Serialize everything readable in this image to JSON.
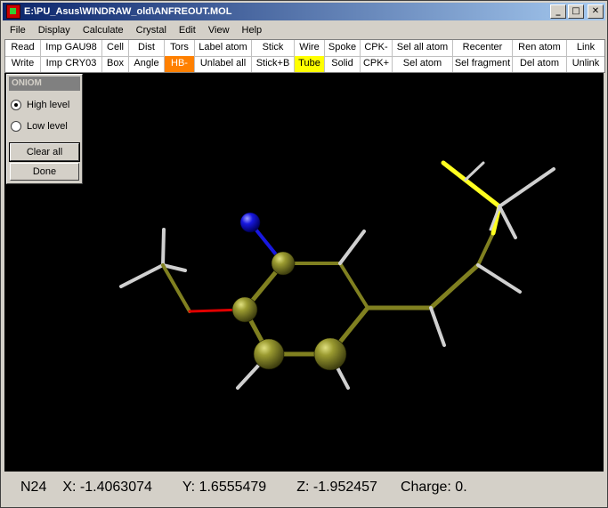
{
  "window": {
    "title": "E:\\PU_Asus\\WINDRAW_old\\ANFREOUT.MOL"
  },
  "menu": [
    "File",
    "Display",
    "Calculate",
    "Crystal",
    "Edit",
    "View",
    "Help"
  ],
  "toolbar": {
    "row1": [
      "Read",
      "Imp GAU98",
      "Cell",
      "Dist",
      "Tors",
      "Label atom",
      "Stick",
      "Wire",
      "Spoke",
      "CPK-",
      "Sel all atom",
      "Recenter",
      "Ren atom",
      "Link"
    ],
    "row2": [
      "Write",
      "Imp CRY03",
      "Box",
      "Angle",
      "HB-",
      "Unlabel all",
      "Stick+B",
      "Tube",
      "Solid",
      "CPK+",
      "Sel atom",
      "Sel fragment",
      "Del atom",
      "Unlink"
    ]
  },
  "oniom": {
    "title": "ONIOM",
    "high_label": "High level",
    "low_label": "Low level",
    "clear_label": "Clear all",
    "done_label": "Done",
    "selected": "High level"
  },
  "status": {
    "atom": "N24",
    "x": "X:  -1.4063074",
    "y": "Y: 1.6555479",
    "z": "Z: -1.952457",
    "charge": "Charge: 0."
  },
  "colors": {
    "carbon": "#808020",
    "nitrogen": "#1010e0",
    "oxygen": "#e00000",
    "sulfur": "#ffff20",
    "hydrogen": "#d0d0d0",
    "hb_button": "#ff8000",
    "tube_button": "#ffff00"
  }
}
